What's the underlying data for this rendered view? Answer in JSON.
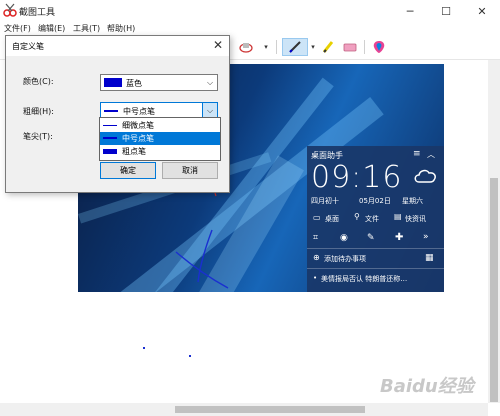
{
  "window": {
    "title": "截图工具"
  },
  "menu": {
    "items": [
      "文件(F)",
      "编辑(E)",
      "工具(T)",
      "帮助(H)"
    ]
  },
  "dialog": {
    "title": "自定义笔",
    "color_label": "颜色(C):",
    "color_value": "蓝色",
    "color_swatch": "#0000cc",
    "thickness_label": "粗细(H):",
    "thickness_value": "中号点笔",
    "tip_label": "笔尖(T):",
    "ok_label": "确定",
    "cancel_label": "取消"
  },
  "dropdown": {
    "options": [
      "细微点笔",
      "中号点笔",
      "粗点笔"
    ],
    "selected": "中号点笔",
    "highlight": "#0078d7"
  },
  "widget": {
    "title": "桌面助手",
    "time": "09:16",
    "date_lunar": "四月初十",
    "date": "05月02日",
    "weekday": "星期六",
    "btn_desktop": "桌面",
    "btn_file": "文件",
    "btn_news": "快资讯",
    "todo": "添加待办事项",
    "news": "美情报局否认 特朗普还称…"
  },
  "watermark": "Baidu经验"
}
